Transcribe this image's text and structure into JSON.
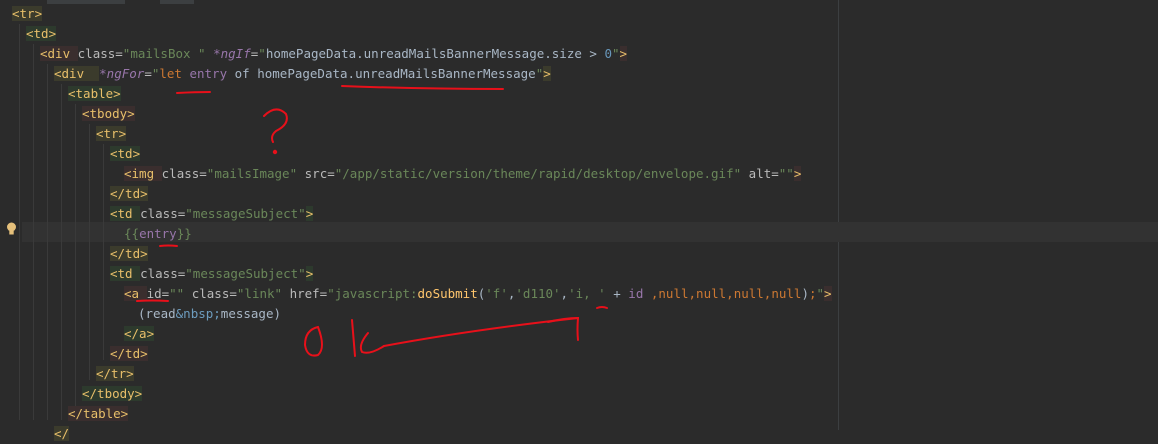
{
  "code_lines": [
    {
      "indent": 0,
      "parts": [
        [
          "tag",
          "<tr>"
        ]
      ]
    },
    {
      "indent": 1,
      "parts": [
        [
          "tag",
          "<td>"
        ]
      ]
    },
    {
      "indent": 2,
      "parts": [
        [
          "tag",
          "<div "
        ],
        [
          "attr",
          "class="
        ],
        [
          "str",
          "\"mailsBox \" "
        ],
        [
          "ang",
          "*ngIf"
        ],
        [
          "attr",
          "="
        ],
        [
          "str",
          "\""
        ],
        [
          "ident",
          "homePageData.unreadMailsBannerMessage.size "
        ],
        [
          "ident",
          "> "
        ],
        [
          "num",
          "0"
        ],
        [
          "str",
          "\""
        ],
        [
          "tag",
          ">"
        ]
      ]
    },
    {
      "indent": 3,
      "parts": [
        [
          "tag",
          "<div  "
        ],
        [
          "ang",
          "*ngFor"
        ],
        [
          "attr",
          "="
        ],
        [
          "str",
          "\""
        ],
        [
          "kw",
          "let "
        ],
        [
          "purple",
          "entry"
        ],
        [
          "ident",
          " of homePageData."
        ],
        [
          "ident",
          "unreadMailsBannerMessage"
        ],
        [
          "str",
          "\""
        ],
        [
          "tag",
          ">"
        ]
      ]
    },
    {
      "indent": 4,
      "parts": [
        [
          "tag",
          "<table>"
        ]
      ]
    },
    {
      "indent": 5,
      "parts": [
        [
          "tag",
          "<tbody>"
        ]
      ]
    },
    {
      "indent": 6,
      "parts": [
        [
          "tag",
          "<tr>"
        ]
      ]
    },
    {
      "indent": 7,
      "parts": [
        [
          "tag",
          "<td>"
        ]
      ]
    },
    {
      "indent": 8,
      "parts": [
        [
          "tag",
          "<img "
        ],
        [
          "attr",
          "class="
        ],
        [
          "str",
          "\"mailsImage\" "
        ],
        [
          "attr",
          "src="
        ],
        [
          "str",
          "\"/app/static/version/theme/rapid/desktop/envelope.gif\" "
        ],
        [
          "attr",
          "alt="
        ],
        [
          "str",
          "\"\""
        ],
        [
          "tag",
          ">"
        ]
      ]
    },
    {
      "indent": 7,
      "parts": [
        [
          "tag",
          "</td>"
        ]
      ]
    },
    {
      "indent": 7,
      "parts": [
        [
          "tag",
          "<td "
        ],
        [
          "attr",
          "class="
        ],
        [
          "str",
          "\"messageSubject\""
        ],
        [
          "tag",
          ">"
        ]
      ]
    },
    {
      "indent": 8,
      "parts": [
        [
          "str",
          "{{"
        ],
        [
          "purple",
          "entry"
        ],
        [
          "str",
          "}}"
        ]
      ]
    },
    {
      "indent": 7,
      "parts": [
        [
          "tag",
          "</td>"
        ]
      ]
    },
    {
      "indent": 7,
      "parts": [
        [
          "tag",
          "<td "
        ],
        [
          "attr",
          "class="
        ],
        [
          "str",
          "\"messageSubject\""
        ],
        [
          "tag",
          ">"
        ]
      ]
    },
    {
      "indent": 8,
      "parts": [
        [
          "tag",
          "<a "
        ],
        [
          "attr",
          "id="
        ],
        [
          "str",
          "\"\" "
        ],
        [
          "attr",
          "class="
        ],
        [
          "str",
          "\"link\" "
        ],
        [
          "attr",
          "href="
        ],
        [
          "str",
          "\"javascript:"
        ],
        [
          "fn",
          "doSubmit"
        ],
        [
          "ident",
          "("
        ],
        [
          "str",
          "'f'"
        ],
        [
          "ident",
          ","
        ],
        [
          "str",
          "'d110'"
        ],
        [
          "ident",
          ","
        ],
        [
          "str",
          "'i, ' "
        ],
        [
          "ident",
          "+ "
        ],
        [
          "purple",
          "id "
        ],
        [
          "kw",
          ","
        ],
        [
          "kw",
          "null"
        ],
        [
          "kw",
          ","
        ],
        [
          "kw",
          "null"
        ],
        [
          "kw",
          ","
        ],
        [
          "kw",
          "null"
        ],
        [
          "kw",
          ","
        ],
        [
          "kw",
          "null"
        ],
        [
          "ident",
          ")"
        ],
        [
          "kw",
          ";"
        ],
        [
          "str",
          "\""
        ],
        [
          "tag",
          ">"
        ]
      ]
    },
    {
      "indent": 9,
      "parts": [
        [
          "ident",
          "(read"
        ],
        [
          "ent",
          "&nbsp;"
        ],
        [
          "ident",
          "message)"
        ]
      ]
    },
    {
      "indent": 8,
      "parts": [
        [
          "tag",
          "</a>"
        ]
      ]
    },
    {
      "indent": 7,
      "parts": [
        [
          "tag",
          "</td>"
        ]
      ]
    },
    {
      "indent": 6,
      "parts": [
        [
          "tag",
          "</tr>"
        ]
      ]
    },
    {
      "indent": 5,
      "parts": [
        [
          "tag",
          "</tbody>"
        ]
      ]
    },
    {
      "indent": 4,
      "parts": [
        [
          "tag",
          "</table>"
        ]
      ]
    },
    {
      "indent": 3,
      "parts": [
        [
          "tag",
          "</"
        ]
      ]
    }
  ],
  "annotations": {
    "question": "?",
    "ok": "O K"
  },
  "colors": {
    "background": "#2b2b2b",
    "ink": "#e8101a",
    "tag": "#e8bf6a",
    "string": "#6a8759"
  }
}
